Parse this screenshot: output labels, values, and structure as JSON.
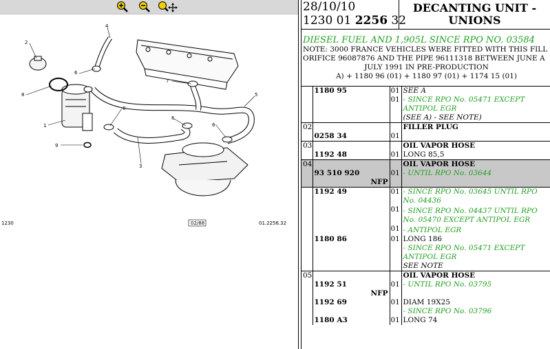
{
  "toolbar": {
    "zoom_in": "zoom-in-icon",
    "zoom_out": "zoom-out-icon",
    "zoom_fit": "zoom-move-icon"
  },
  "diagram": {
    "callouts": [
      "1",
      "2",
      "3",
      "4",
      "5",
      "6",
      "6",
      "6",
      "6",
      "7",
      "7",
      "8",
      "9"
    ],
    "footer_left": "1230",
    "footer_mid": "02/88",
    "footer_right": "01.2256.32"
  },
  "header": {
    "date": "28/10/10",
    "ref_prefix": "1230 01 ",
    "ref_bold": "2256",
    "ref_suffix": " 32",
    "title_line1": "DECANTING UNIT -",
    "title_line2": "UNIONS"
  },
  "notes": {
    "green": "DIESEL FUEL AND 1,905L SINCE RPO NO. 03584",
    "line1": "NOTE: 3000 FRANCE VEHICLES WERE FITTED WITH THIS FILL",
    "line2": "ORIFICE 96087876 AND THE PIPE 96111318 BETWEEN JUNE A",
    "line3": "JULY 1991 IN PRE-PRODUCTION",
    "line4": "A) + 1180 96 (01) + 1180 97 (01) + 1174 15 (01)"
  },
  "parts": {
    "r1_pn": "1180 95",
    "r1_qty": "01",
    "r1_desc": "SEE A",
    "r1b_qty": "01",
    "r1b_desc1": "- SINCE RPO No. 05471 EXCEPT ANTIPOL EGR",
    "r1b_desc2": "(SEE A) - SEE NOTE)",
    "r2_item": "02",
    "r2_title": "FILLER PLUG",
    "r2_pn": "0258 34",
    "r2_qty": "01",
    "r3_item": "03",
    "r3_title": "OIL VAPOR HOSE",
    "r3_pn": "1192 48",
    "r3_qty": "01",
    "r3_desc": "LONG 85,5",
    "r4_item": "04",
    "r4_title": "OIL VAPOR HOSE",
    "r4_pn": "93 510 920",
    "r4_qty": "01",
    "r4_desc": "- UNTIL RPO No. 03644",
    "r4_nfp": "NFP",
    "r5_pn": "1192 49",
    "r5_qty": "01",
    "r5_desc": "- SINCE RPO No. 03645 UNTIL RPO No. 04436",
    "r5b_qty": "01",
    "r5b_desc": "- SINCE RPO No. 04437 UNTIL RPO No. 05470 EXCEPT ANTIPOL EGR",
    "r5c_qty": "01",
    "r5c_desc": "- ANTIPOL EGR",
    "r6_pn": "1180 86",
    "r6_qty": "01",
    "r6_desc1": "LONG 186",
    "r6_desc2": "- SINCE RPO No. 05471 EXCEPT ANTIPOL EGR",
    "r6_desc3": "SEE NOTE",
    "r7_item": "05",
    "r7_title": "OIL VAPOR HOSE",
    "r7_pn": "1192 51",
    "r7_qty": "01",
    "r7_desc": "- UNTIL RPO No. 03795",
    "r7_nfp": "NFP",
    "r8_pn": "1192 69",
    "r8_qty": "01",
    "r8_desc1": "DIAM 19X25",
    "r8_desc2": "- SINCE RPO No. 03796",
    "r9_pn": "1180 A3",
    "r9_qty": "01",
    "r9_desc": "LONG 74"
  },
  "colors": {
    "green_text": "#1f9e1f",
    "toolbar_bg": "#d8d8d8",
    "highlight_row": "#c8c8c8",
    "zoom_icon": "#f0d000"
  }
}
